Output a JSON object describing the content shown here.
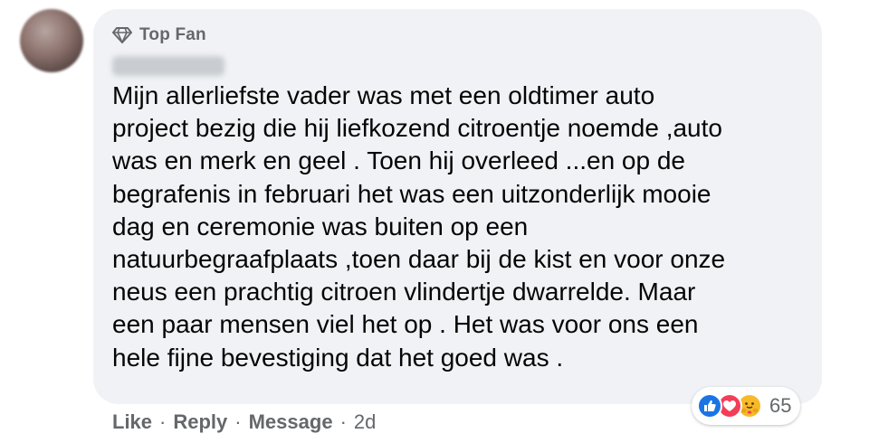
{
  "comment": {
    "badge": "Top Fan",
    "badge_icon": "diamond-icon",
    "text": "Mijn allerliefste vader was met een oldtimer auto project bezig die hij liefkozend citroentje noemde ,auto was en merk en geel . Toen hij overleed ...en op de begrafenis in februari het was een uitzonderlijk mooie dag en ceremonie was buiten op een natuurbegraafplaats ,toen daar bij de kist en voor onze neus een prachtig citroen vlindertje dwarrelde. Maar een paar mensen viel het op . Het was voor ons een hele fijne bevestiging dat het goed was .",
    "lines": [
      "Mijn allerliefste vader was met een oldtimer auto",
      "project bezig die hij liefkozend citroentje noemde ,auto",
      "was en merk en geel . Toen hij overleed ...en op de",
      "begrafenis in februari het was een uitzonderlijk mooie",
      "dag en ceremonie was buiten op een",
      "natuurbegraafplaats ,toen daar bij de kist en voor onze",
      "neus een prachtig citroen vlindertje dwarrelde. Maar",
      "een paar mensen viel het op . Het was voor ons een",
      "hele fijne bevestiging dat het goed was ."
    ]
  },
  "reactions": {
    "icons": [
      "like-icon",
      "love-icon",
      "care-icon"
    ],
    "count": "65"
  },
  "actions": {
    "like": "Like",
    "reply": "Reply",
    "message": "Message",
    "separator": "·",
    "time": "2d"
  },
  "colors": {
    "bubble": "#f0f2f5",
    "text": "#050505",
    "secondary": "#65676b",
    "like_blue": "#1b74e4",
    "love_red": "#f33e58",
    "care_yellow": "#f7b928"
  }
}
